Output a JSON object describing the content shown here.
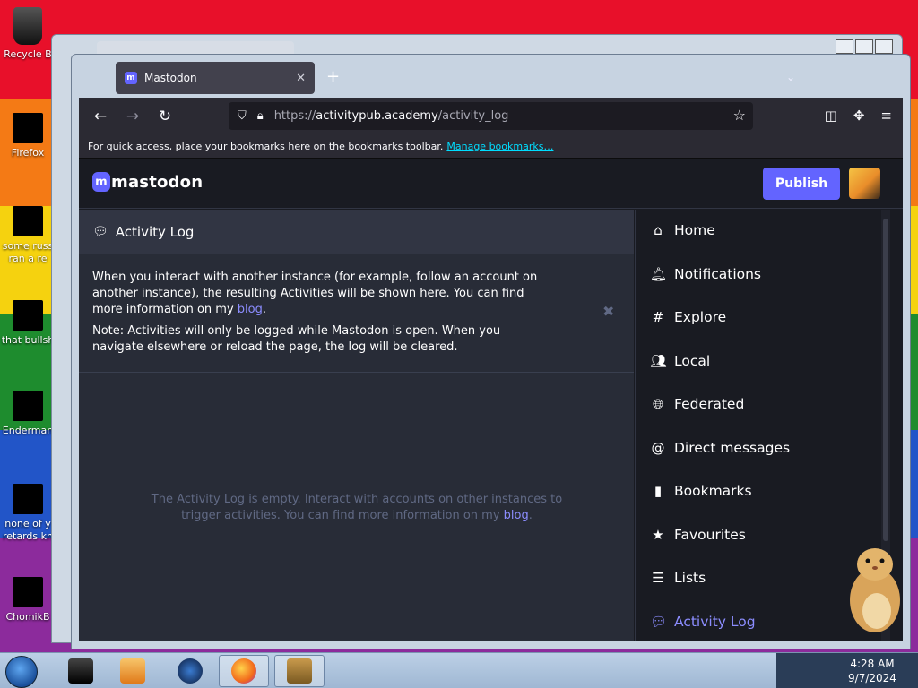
{
  "desktop": {
    "icons": [
      {
        "label": "Recycle B",
        "top": 0
      },
      {
        "label": "Firefox",
        "top": 0
      },
      {
        "label": "some russ ran a re",
        "top": 0
      },
      {
        "label": "that bullsh",
        "top": 0
      },
      {
        "label": "Enderman",
        "top": 0
      },
      {
        "label": "none of y retards kn",
        "top": 0
      },
      {
        "label": "ChomikB",
        "top": 0
      }
    ]
  },
  "browser": {
    "tab": {
      "title": "Mastodon",
      "favicon": "m",
      "close": "✕"
    },
    "new_tab": "+",
    "url": {
      "scheme": "https://",
      "host": "activitypub.academy",
      "path": "/activity_log"
    },
    "bookmarks_hint": "For quick access, place your bookmarks here on the bookmarks toolbar.",
    "bookmarks_link": "Manage bookmarks…"
  },
  "mastodon": {
    "logo_text": "mastodon",
    "logo_mark": "m",
    "publish_label": "Publish",
    "column_title": "Activity Log",
    "info_p1_a": "When you interact with another instance (for example, follow an account on another instance), the resulting Activities will be shown here. You can find more information on my ",
    "info_p1_link": "blog",
    "info_p1_b": ".",
    "info_p2": "Note: Activities will only be logged while Mastodon is open. When you navigate elsewhere or reload the page, the log will be cleared.",
    "dismiss": "✖",
    "empty_a": "The Activity Log is empty. Interact with accounts on other instances to trigger activities. You can find more information on my ",
    "empty_link": "blog",
    "empty_b": ".",
    "nav": [
      {
        "label": "Home",
        "icon": "home-icon"
      },
      {
        "label": "Notifications",
        "icon": "bell-icon"
      },
      {
        "label": "Explore",
        "icon": "hashtag-icon"
      },
      {
        "label": "Local",
        "icon": "users-icon"
      },
      {
        "label": "Federated",
        "icon": "globe-icon"
      },
      {
        "label": "Direct messages",
        "icon": "at-icon"
      },
      {
        "label": "Bookmarks",
        "icon": "bookmark-icon"
      },
      {
        "label": "Favourites",
        "icon": "star-icon"
      },
      {
        "label": "Lists",
        "icon": "list-icon"
      },
      {
        "label": "Activity Log",
        "icon": "comments-icon",
        "active": true
      }
    ],
    "accent": "#6364ff"
  },
  "taskbar": {
    "time": "4:28 AM",
    "date": "9/7/2024"
  }
}
